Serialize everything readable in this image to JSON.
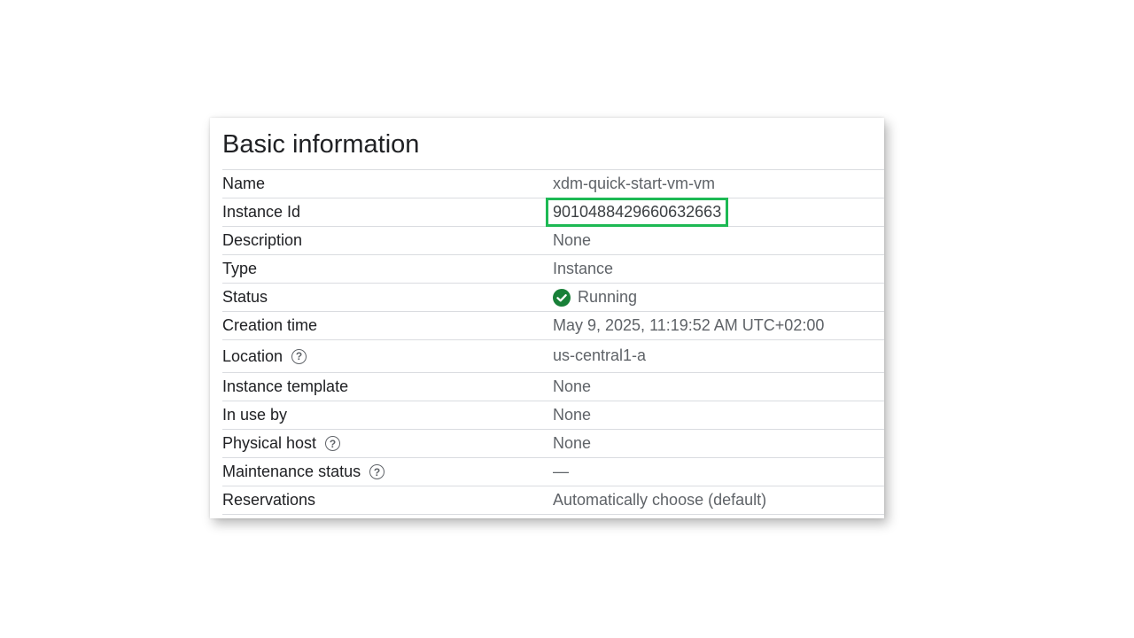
{
  "panel": {
    "title": "Basic information"
  },
  "rows": {
    "name": {
      "label": "Name",
      "value": "xdm-quick-start-vm-vm"
    },
    "instance_id": {
      "label": "Instance Id",
      "value": "9010488429660632663"
    },
    "description": {
      "label": "Description",
      "value": "None"
    },
    "type": {
      "label": "Type",
      "value": "Instance"
    },
    "status": {
      "label": "Status",
      "value": "Running"
    },
    "creation_time": {
      "label": "Creation time",
      "value": "May 9, 2025, 11:19:52 AM UTC+02:00"
    },
    "location": {
      "label": "Location",
      "value": "us-central1-a"
    },
    "instance_template": {
      "label": "Instance template",
      "value": "None"
    },
    "in_use_by": {
      "label": "In use by",
      "value": "None"
    },
    "physical_host": {
      "label": "Physical host",
      "value": "None"
    },
    "maintenance_status": {
      "label": "Maintenance status",
      "value": "—"
    },
    "reservations": {
      "label": "Reservations",
      "value": "Automatically choose (default)"
    }
  },
  "icons": {
    "help": "?",
    "status_ok": "check-circle-icon"
  },
  "colors": {
    "highlight": "#1db954",
    "status_ok": "#188038"
  }
}
